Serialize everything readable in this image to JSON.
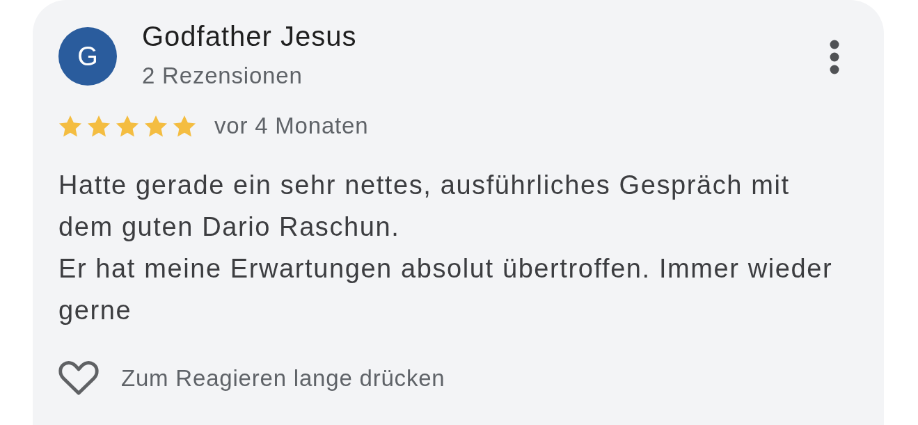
{
  "review": {
    "author": {
      "initial": "G",
      "name": "Godfather Jesus",
      "review_count": "2 Rezensionen"
    },
    "stars": 5,
    "time": "vor 4 Monaten",
    "paragraphs": [
      "Hatte gerade ein sehr nettes, ausführliches Gespräch mit dem guten Dario Raschun.",
      "Er hat meine Erwartungen absolut übertroffen. Immer wieder gerne"
    ],
    "reaction_hint": "Zum Reagieren lange drücken"
  }
}
